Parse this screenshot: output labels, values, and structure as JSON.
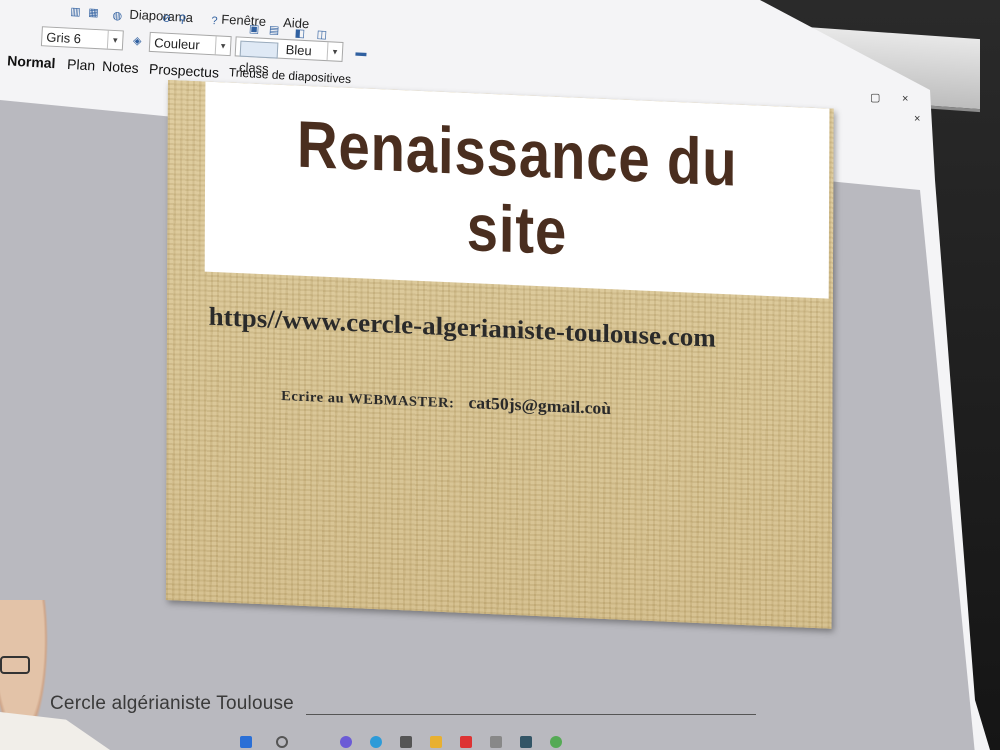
{
  "menubar": {
    "items": [
      "Diaporama",
      "Fenêtre",
      "Aide"
    ]
  },
  "toolbar": {
    "line_color_value": "Gris 6",
    "fill_mode_value": "Couleur",
    "fill_color_value": "Bleu class"
  },
  "view_tabs": [
    "Normal",
    "Plan",
    "Notes",
    "Prospectus",
    "Trieuse de diapositives"
  ],
  "window_controls": {
    "minimize": "▢",
    "close": "×",
    "close_doc": "×"
  },
  "slide": {
    "title_line1": "Renaissance du",
    "title_line2": "site",
    "url": "https//www.cercle-algerianiste-toulouse.com",
    "contact_label": "Ecrire au  WEBMASTER:",
    "contact_email": "cat50js@gmail.coù"
  },
  "watermark": "Cercle algérianiste Toulouse",
  "colors": {
    "title_text": "#4a2e1f",
    "slide_background": "#d9c493",
    "work_area": "#b9b9bf"
  }
}
